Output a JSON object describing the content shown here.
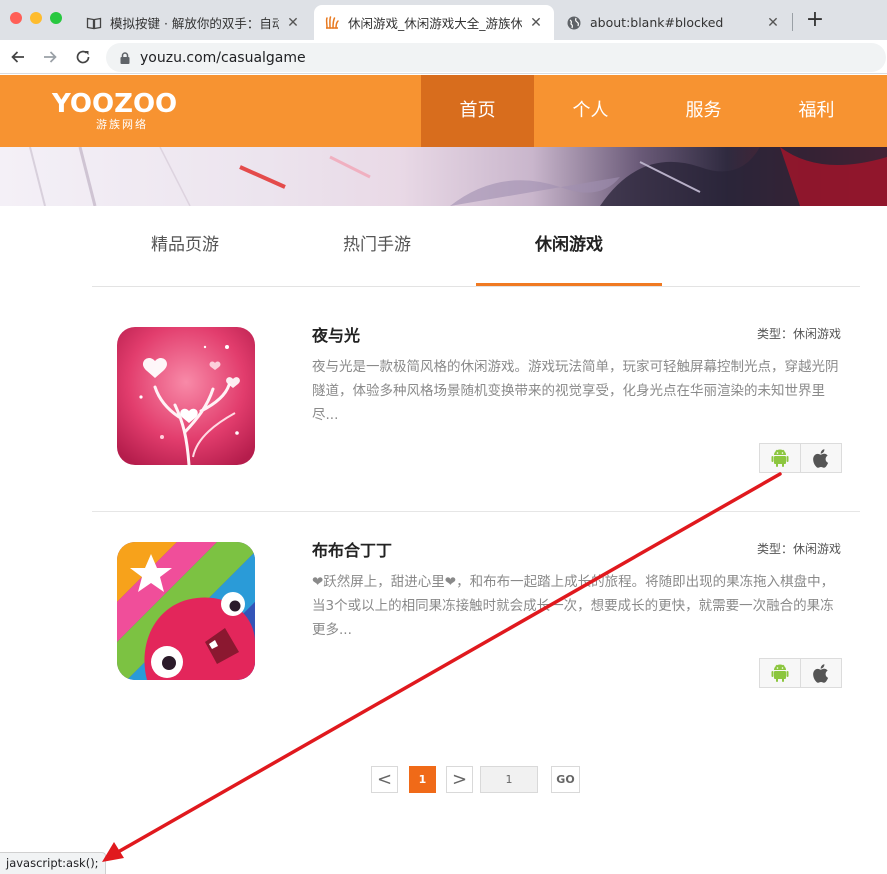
{
  "browser": {
    "tabs": [
      {
        "title": "模拟按键 · 解放你的双手：自动化",
        "icon": "book-icon",
        "close": "✕"
      },
      {
        "title": "休闲游戏_休闲游戏大全_游族休闲",
        "icon": "yoozoo-favicon",
        "close": "✕"
      },
      {
        "title": "about:blank#blocked",
        "icon": "globe-icon",
        "close": "✕"
      }
    ],
    "new_tab": "+",
    "url": "youzu.com/casualgame",
    "status_text": "javascript:ask();"
  },
  "site": {
    "logo_main": "YOOZOO",
    "logo_sub": "游族网络",
    "nav": [
      "首页",
      "个人",
      "服务",
      "福利"
    ],
    "active_nav": "首页",
    "accent": "#f79331",
    "accent_dark": "#d86d1d"
  },
  "category_tabs": [
    "精品页游",
    "热门手游",
    "休闲游戏"
  ],
  "active_category": "休闲游戏",
  "games": [
    {
      "title": "夜与光",
      "type": "类型：休闲游戏",
      "desc": "夜与光是一款极简风格的休闲游戏。游戏玩法简单，玩家可轻触屏幕控制光点，穿越光阴隧道，体验多种风格场景随机变换带来的视觉享受，化身光点在华丽渲染的未知世界里尽..."
    },
    {
      "title": "布布合丁丁",
      "type": "类型：休闲游戏",
      "desc": "❤跃然屏上，甜进心里❤，和布布一起踏上成长的旅程。将随即出现的果冻拖入棋盘中，当3个或以上的相同果冻接触时就会成长一次，想要成长的更快，就需要一次融合的果冻更多..."
    }
  ],
  "pager": {
    "prev": "<",
    "current": "1",
    "next": ">",
    "input_value": "1",
    "go": "GO"
  },
  "annotation_color": "#e0191e"
}
